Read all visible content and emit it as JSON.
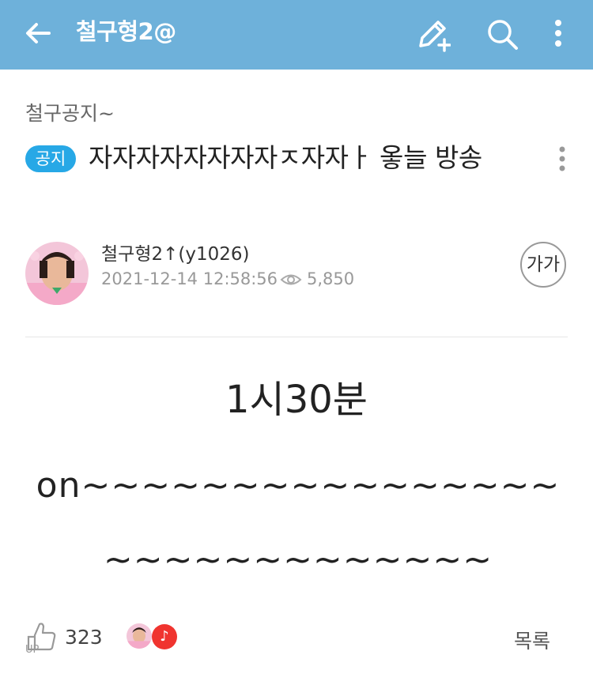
{
  "header": {
    "title": "철구형2@",
    "background_color": "#6eb1da",
    "icons": [
      "back-arrow-icon",
      "write-post-icon",
      "search-icon",
      "more-vertical-icon"
    ]
  },
  "post": {
    "category": "철구공지~",
    "badge": "공지",
    "badge_color": "#27a8e6",
    "title": "자자자자자자자자ㅈ자자ㅏ 옿늘 방송",
    "author": "철구형2↑(y1026)",
    "date": "2021-12-14 12:58:56",
    "views": "5,850",
    "font_size_button": "가가",
    "body": {
      "line1": "1시30분",
      "line2": "on~~~~~~~~~~~~~~~~~~~~~~~~~~~~~"
    }
  },
  "footer": {
    "likes": "323",
    "reaction_badge": "♪",
    "list_label": "목록"
  }
}
